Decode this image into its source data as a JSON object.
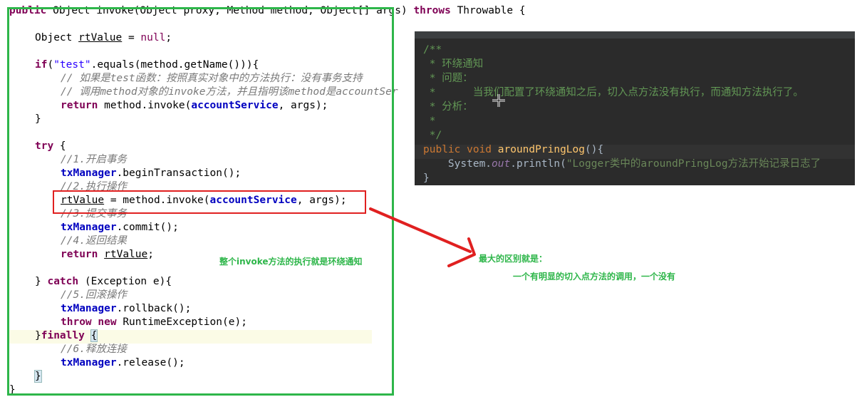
{
  "editor": {
    "lines": [
      "public Object invoke(Object proxy, Method method, Object[] args) throws Throwable {",
      "Object rtValue = null;",
      "if(\"test\".equals(method.getName())){",
      "// 如果是test函数：按照真实对象中的方法执行：没有事务支持",
      "// 调用method对象的invoke方法，并且指明该method是accountSer",
      "return method.invoke(accountService, args);",
      "}",
      "try {",
      "//1.开启事务",
      "txManager.beginTransaction();",
      "//2.执行操作",
      "rtValue = method.invoke(accountService, args);",
      "//3.提交事务",
      "txManager.commit();",
      "//4.返回结果",
      "return rtValue;",
      "} catch (Exception e){",
      "//5.回滚操作",
      "txManager.rollback();",
      "throw new RuntimeException(e);",
      "}finally {",
      "//6.释放连接",
      "txManager.release();",
      "}",
      "}"
    ]
  },
  "dark_panel": {
    "lines": [
      "/**",
      " * 环绕通知",
      " * 问题：",
      " *      当我们配置了环绕通知之后，切入点方法没有执行，而通知方法执行了。",
      " * 分析：",
      " *",
      " */",
      "public void aroundPringLog(){",
      "    System.out.println(\"Logger类中的aroundPringLog方法开始记录日志了",
      "}"
    ]
  },
  "annotations": {
    "invoke_note": "整个invoke方法的执行就是环绕通知",
    "difference_title": "最大的区别就是：",
    "difference_detail": "一个有明显的切入点方法的调用，一个没有"
  },
  "colors": {
    "frame_green": "#2eb64a",
    "box_red": "#e02020",
    "arrow_red": "#e02020"
  }
}
